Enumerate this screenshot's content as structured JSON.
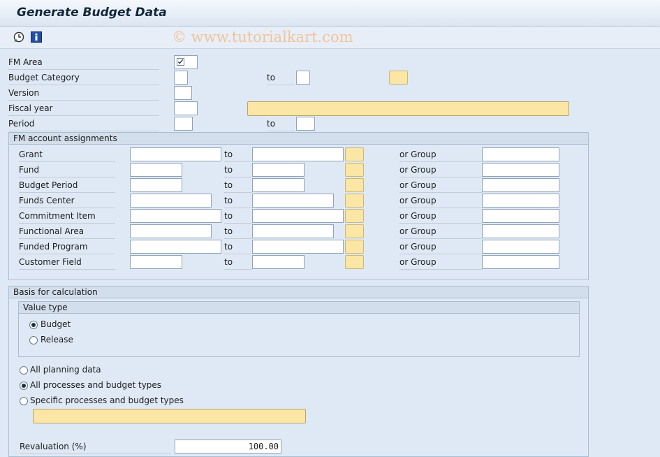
{
  "window": {
    "title": "Generate Budget Data"
  },
  "toolbar": {
    "execute_icon": "clock-execute-icon",
    "info_icon": "info-icon"
  },
  "watermark": "© www.tutorialkart.com",
  "selection": {
    "fm_area": {
      "label": "FM Area",
      "checked": true
    },
    "budget_category": {
      "label": "Budget Category",
      "to": "to"
    },
    "version": {
      "label": "Version"
    },
    "fiscal_year": {
      "label": "Fiscal year"
    },
    "period": {
      "label": "Period",
      "to": "to"
    }
  },
  "fm_account_assignments": {
    "title": "FM account assignments",
    "to": "to",
    "or_group": "or Group",
    "rows": [
      {
        "label": "Grant"
      },
      {
        "label": "Fund"
      },
      {
        "label": "Budget Period"
      },
      {
        "label": "Funds Center"
      },
      {
        "label": "Commitment Item"
      },
      {
        "label": "Functional Area"
      },
      {
        "label": "Funded Program"
      },
      {
        "label": "Customer Field"
      }
    ]
  },
  "basis": {
    "title": "Basis for calculation",
    "value_type": {
      "title": "Value type",
      "options": [
        {
          "label": "Budget",
          "selected": true
        },
        {
          "label": "Release",
          "selected": false
        }
      ]
    },
    "processes": [
      {
        "label": "All planning data",
        "selected": false
      },
      {
        "label": "All processes and budget types",
        "selected": true
      },
      {
        "label": "Specific processes and budget types",
        "selected": false
      }
    ],
    "revaluation": {
      "label": "Revaluation (%)",
      "value": "100.00"
    }
  },
  "colors": {
    "background": "#dfe9f5",
    "accent_yellow": "#fbe6a5",
    "group_border": "#a9bdd3"
  }
}
